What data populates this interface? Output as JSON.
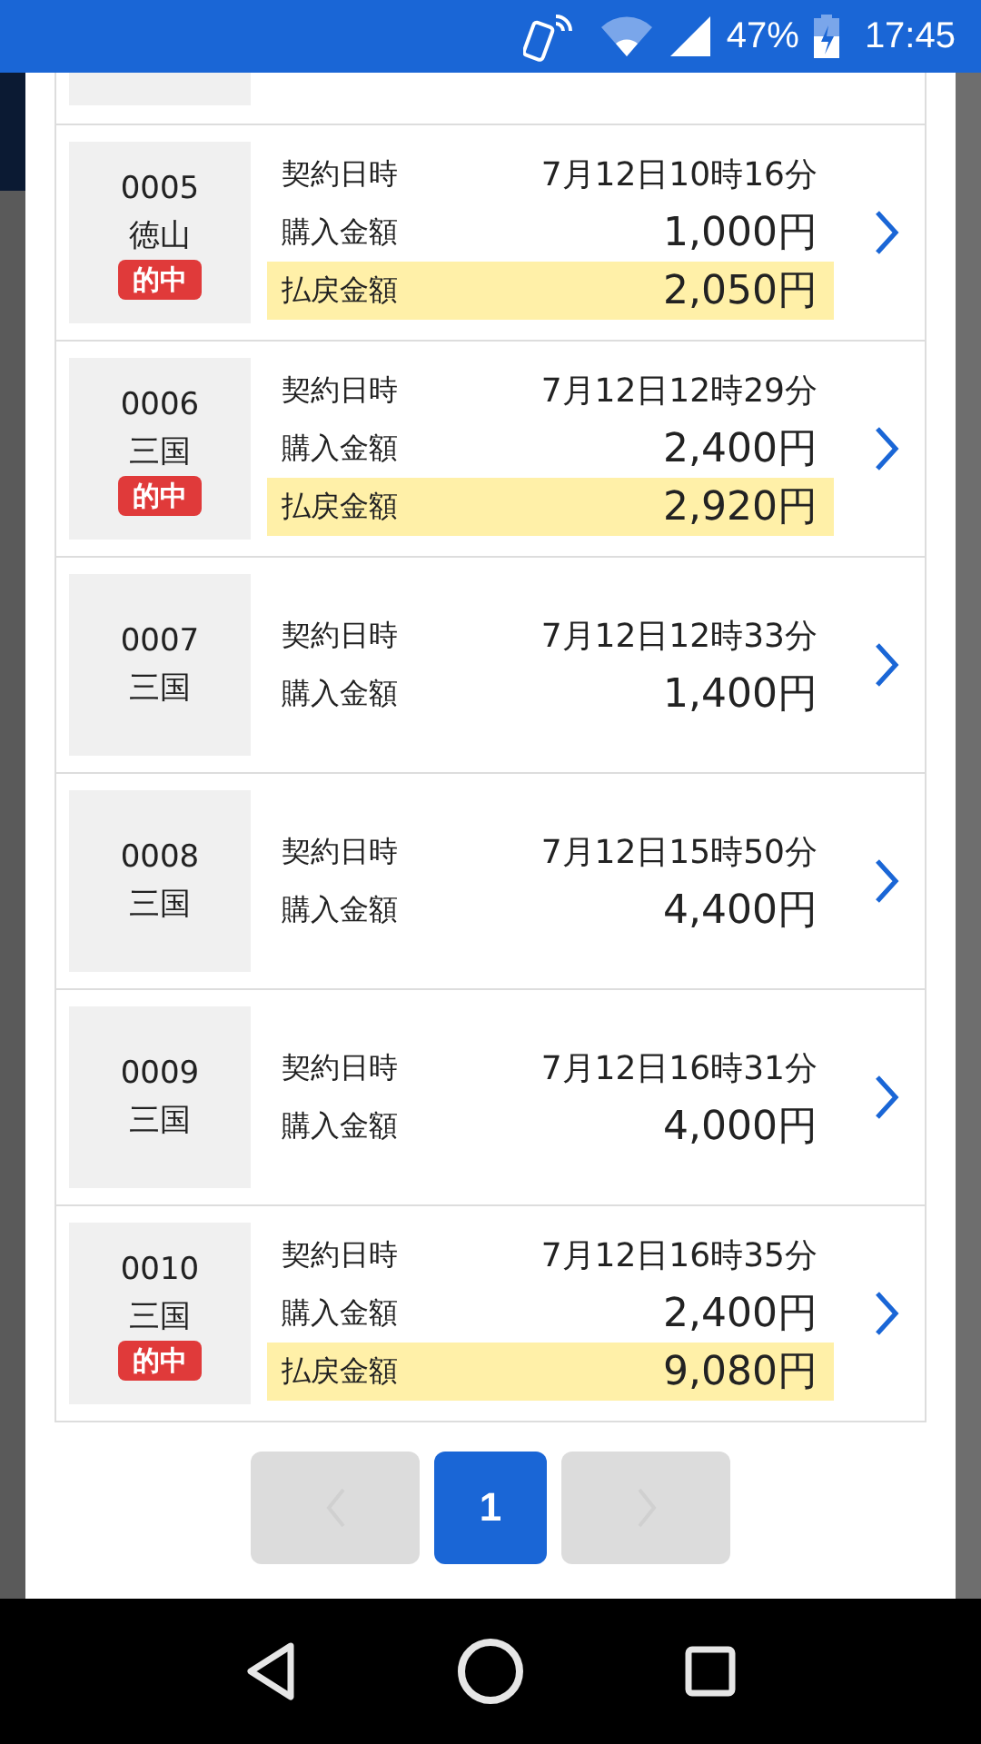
{
  "status_bar": {
    "battery": "47%",
    "time": "17:45"
  },
  "tickets": [
    {
      "number": "0005",
      "venue": "徳山",
      "badge": "的中",
      "rows": [
        {
          "label": "契約日時",
          "value": "7月12日10時16分"
        },
        {
          "label": "購入金額",
          "value": "1,000円"
        }
      ],
      "payout": {
        "label": "払戻金額",
        "value": "2,050円"
      }
    },
    {
      "number": "0006",
      "venue": "三国",
      "badge": "的中",
      "rows": [
        {
          "label": "契約日時",
          "value": "7月12日12時29分"
        },
        {
          "label": "購入金額",
          "value": "2,400円"
        }
      ],
      "payout": {
        "label": "払戻金額",
        "value": "2,920円"
      }
    },
    {
      "number": "0007",
      "venue": "三国",
      "rows": [
        {
          "label": "契約日時",
          "value": "7月12日12時33分"
        },
        {
          "label": "購入金額",
          "value": "1,400円"
        }
      ]
    },
    {
      "number": "0008",
      "venue": "三国",
      "rows": [
        {
          "label": "契約日時",
          "value": "7月12日15時50分"
        },
        {
          "label": "購入金額",
          "value": "4,400円"
        }
      ]
    },
    {
      "number": "0009",
      "venue": "三国",
      "rows": [
        {
          "label": "契約日時",
          "value": "7月12日16時31分"
        },
        {
          "label": "購入金額",
          "value": "4,000円"
        }
      ]
    },
    {
      "number": "0010",
      "venue": "三国",
      "badge": "的中",
      "rows": [
        {
          "label": "契約日時",
          "value": "7月12日16時35分"
        },
        {
          "label": "購入金額",
          "value": "2,400円"
        }
      ],
      "payout": {
        "label": "払戻金額",
        "value": "9,080円"
      }
    }
  ],
  "pagination": {
    "prev_disabled": true,
    "pages": [
      {
        "label": "1",
        "selected": true
      }
    ],
    "next_disabled": true
  }
}
